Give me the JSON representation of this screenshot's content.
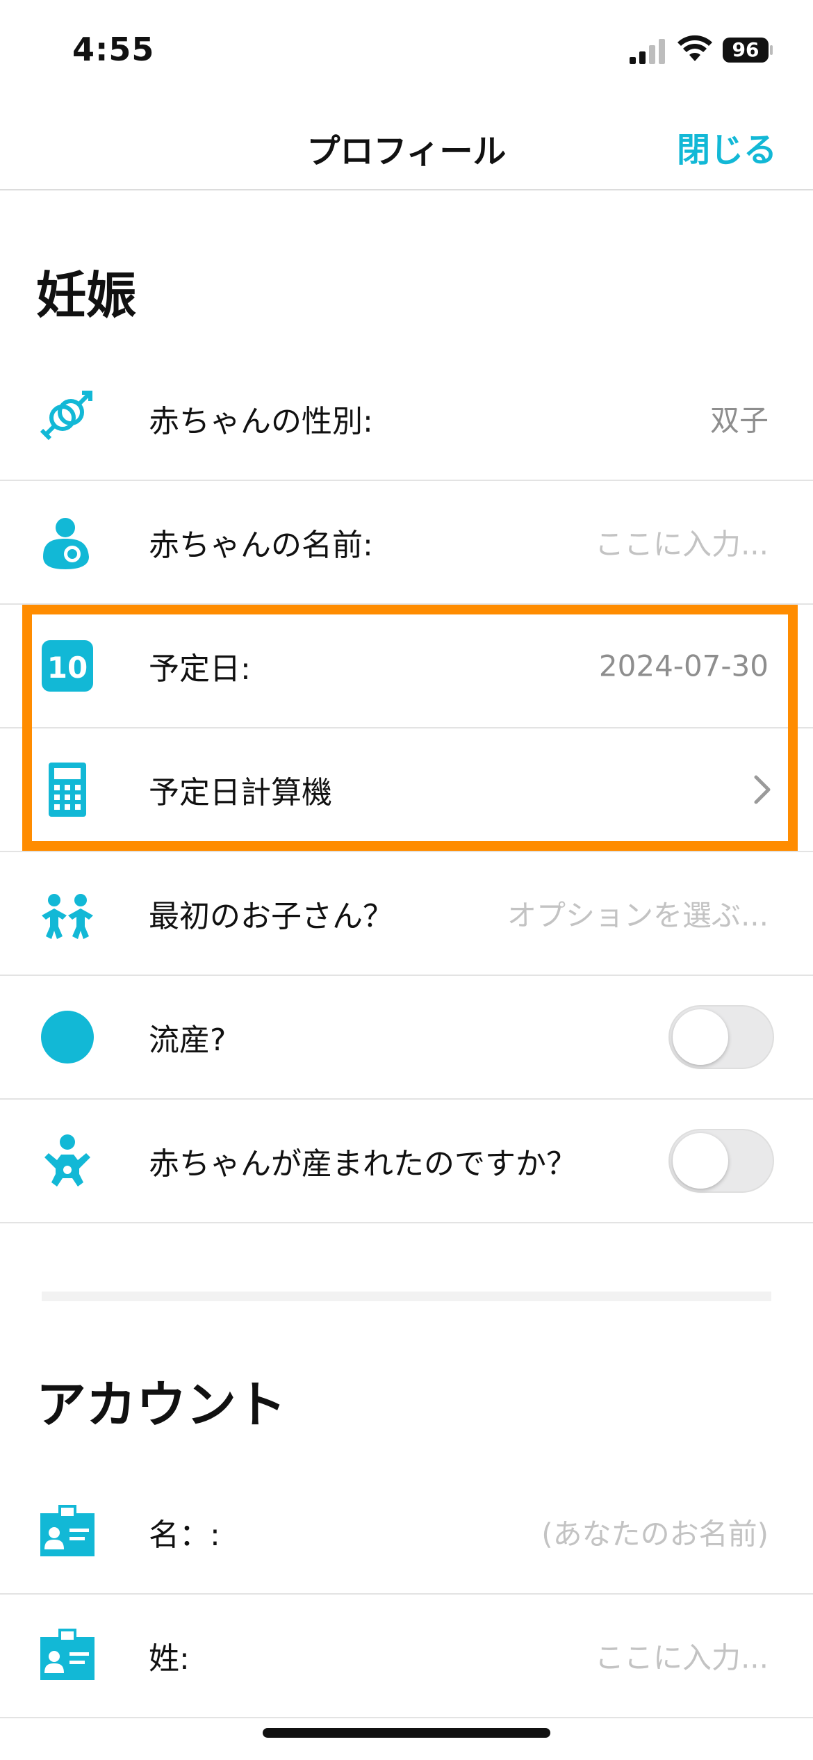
{
  "status_bar": {
    "time": "4:55",
    "battery": "96"
  },
  "nav": {
    "title": "プロフィール",
    "close_label": "閉じる"
  },
  "sections": {
    "pregnancy": {
      "title": "妊娠",
      "rows": {
        "gender": {
          "label": "赤ちゃんの性別:",
          "value": "双子",
          "icon": "gender-icon"
        },
        "baby_name": {
          "label": "赤ちゃんの名前:",
          "placeholder": "ここに入力...",
          "icon": "baby-name-icon"
        },
        "due_date": {
          "label": "予定日:",
          "value": "2024-07-30",
          "icon": "calendar-icon",
          "icon_text": "10"
        },
        "calculator": {
          "label": "予定日計算機",
          "icon": "calculator-icon"
        },
        "first_child": {
          "label": "最初のお子さん？",
          "placeholder": "オプションを選ぶ...",
          "icon": "children-icon"
        },
        "miscarriage": {
          "label": "流産?",
          "toggle_on": false,
          "icon": "circle-icon"
        },
        "born": {
          "label": "赤ちゃんが産まれたのですか？",
          "toggle_on": false,
          "icon": "baby-icon"
        }
      }
    },
    "account": {
      "title": "アカウント",
      "rows": {
        "first_name": {
          "label": "名：:",
          "placeholder": "(あなたのお名前)",
          "icon": "id-card-icon"
        },
        "last_name": {
          "label": "姓:",
          "placeholder": "ここに入力...",
          "icon": "id-card-icon"
        }
      }
    }
  },
  "colors": {
    "accent": "#12b8d6",
    "highlight": "#ff8c00"
  }
}
